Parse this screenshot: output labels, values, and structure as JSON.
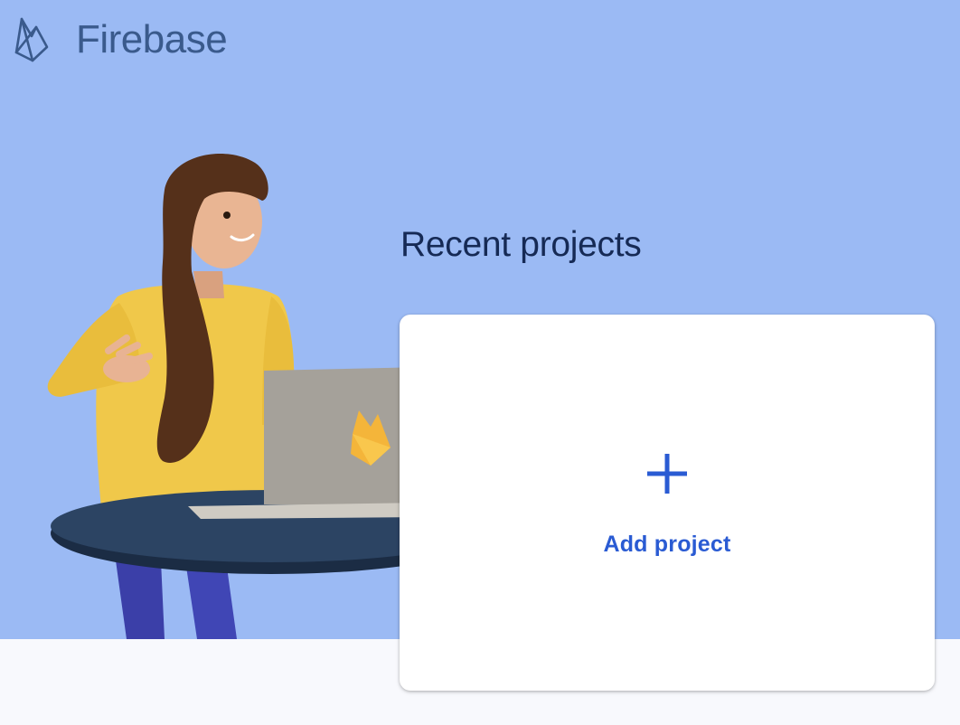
{
  "brand": {
    "name": "Firebase",
    "icon": "firebase-flame-outline-icon"
  },
  "recent": {
    "title": "Recent projects"
  },
  "add_project": {
    "label": "Add project",
    "icon": "plus-icon"
  },
  "colors": {
    "hero_background": "#9bbaf4",
    "page_background": "#f8f9fd",
    "title_text": "#162a55",
    "brand_text": "#3a5a8c",
    "accent": "#2a5bd3",
    "card_background": "#ffffff"
  }
}
